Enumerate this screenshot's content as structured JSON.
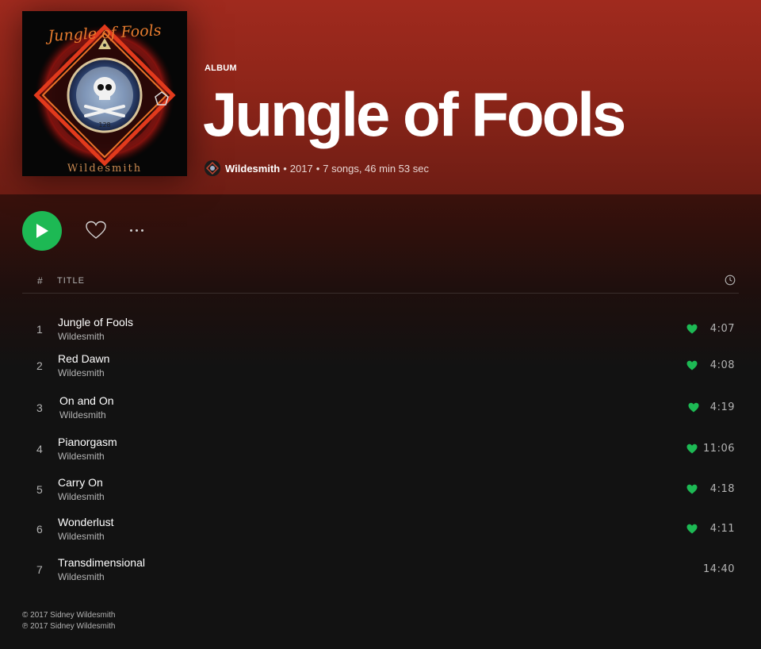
{
  "album": {
    "type_label": "ALBUM",
    "title": "Jungle of Fools",
    "cover_top_text": "Jungle of Fools",
    "cover_bottom_text": "Wildesmith",
    "artist": "Wildesmith",
    "separator": "•",
    "year": "2017",
    "stats": "7 songs, 46 min 53 sec"
  },
  "actions": {
    "play_icon": "play-icon",
    "like_icon": "heart-outline-icon",
    "more_icon": "more-horizontal-icon"
  },
  "table": {
    "col_num": "#",
    "col_title": "TITLE",
    "col_duration_icon": "clock-icon"
  },
  "tracks": [
    {
      "num": "1",
      "title": "Jungle of Fools",
      "artist": "Wildesmith",
      "liked": true,
      "duration": "4:07"
    },
    {
      "num": "2",
      "title": "Red Dawn",
      "artist": "Wildesmith",
      "liked": true,
      "duration": "4:08"
    },
    {
      "num": "3",
      "title": "On and On",
      "artist": "Wildesmith",
      "liked": true,
      "duration": "4:19"
    },
    {
      "num": "4",
      "title": "Pianorgasm",
      "artist": "Wildesmith",
      "liked": true,
      "duration": "11:06"
    },
    {
      "num": "5",
      "title": "Carry On",
      "artist": "Wildesmith",
      "liked": true,
      "duration": "4:18"
    },
    {
      "num": "6",
      "title": "Wonderlust",
      "artist": "Wildesmith",
      "liked": true,
      "duration": "4:11"
    },
    {
      "num": "7",
      "title": "Transdimensional",
      "artist": "Wildesmith",
      "liked": false,
      "duration": "14:40"
    }
  ],
  "copyright": {
    "c_line": "© 2017 Sidney Wildesmith",
    "p_line": "℗ 2017 Sidney Wildesmith"
  },
  "colors": {
    "accent_green": "#1db954",
    "hero_red": "#a02a1e",
    "background": "#121212"
  }
}
